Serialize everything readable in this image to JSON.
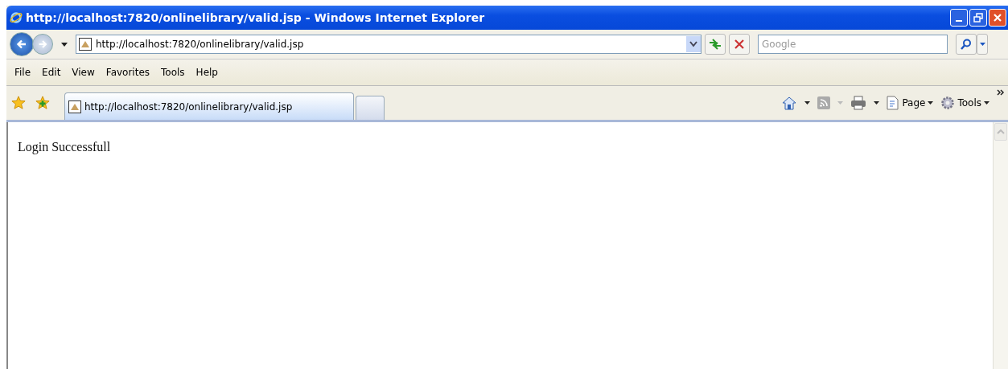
{
  "window": {
    "title": "http://localhost:7820/onlinelibrary/valid.jsp - Windows Internet Explorer"
  },
  "address_bar": {
    "url": "http://localhost:7820/onlinelibrary/valid.jsp"
  },
  "search": {
    "placeholder": "Google"
  },
  "menu": [
    "File",
    "Edit",
    "View",
    "Favorites",
    "Tools",
    "Help"
  ],
  "tabs": [
    {
      "label": "http://localhost:7820/onlinelibrary/valid.jsp",
      "selected": true
    }
  ],
  "command_bar": [
    "Page",
    "Tools"
  ],
  "page": {
    "text": "Login Successfull"
  }
}
